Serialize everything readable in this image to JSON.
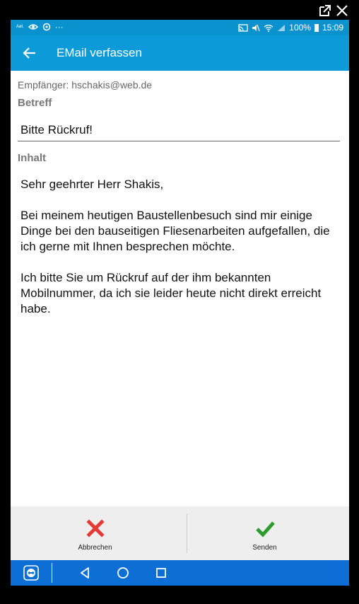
{
  "statusbar": {
    "tiny_text": "Aøl.",
    "battery": "100%",
    "time": "15:09"
  },
  "appbar": {
    "title": "EMail verfassen"
  },
  "form": {
    "recipient": "Empfänger: hschakis@web.de",
    "subject_label": "Betreff",
    "subject_value": "Bitte Rückruf!",
    "content_label": "Inhalt",
    "content_value": "Sehr geehrter Herr Shakis,\n\nBei meinem heutigen Baustellenbesuch sind mir einige Dinge bei den bauseitigen Fliesenarbeiten aufgefallen, die ich gerne mit Ihnen besprechen möchte.\n\nIch bitte Sie um Rückruf auf der ihm bekannten Mobilnummer, da ich sie leider heute nicht direkt erreicht habe."
  },
  "actions": {
    "cancel_label": "Abbrechen",
    "send_label": "Senden"
  },
  "colors": {
    "appbar": "#0d9ad8",
    "statusbar": "#0a92cf",
    "navbar": "#0d6fd6",
    "cancel": "#e53935",
    "send": "#2e9b2e"
  }
}
